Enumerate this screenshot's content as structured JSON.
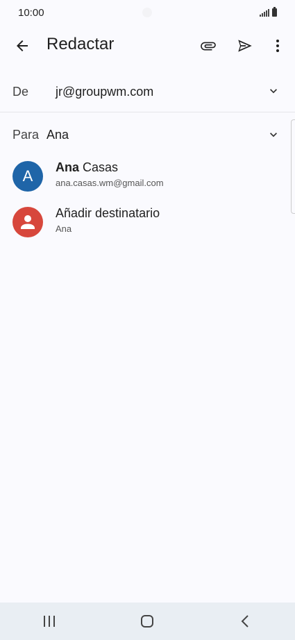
{
  "status": {
    "time": "10:00"
  },
  "app_bar": {
    "title": "Redactar"
  },
  "compose": {
    "from_label": "De",
    "from_value": "jr@groupwm.com",
    "to_label": "Para",
    "to_value": "Ana"
  },
  "suggestions": [
    {
      "initial": "A",
      "name_bold": "Ana",
      "name_rest": " Casas",
      "email": "ana.casas.wm@gmail.com",
      "avatar_color": "#1f65a8"
    },
    {
      "label": "Añadir destinatario",
      "sub": "Ana",
      "avatar_color": "#d7473c"
    }
  ],
  "icons": [
    "back-arrow-icon",
    "attach-icon",
    "send-icon",
    "more-vert-icon",
    "chevron-down-icon",
    "person-icon",
    "recents-icon",
    "home-icon",
    "nav-back-icon"
  ]
}
